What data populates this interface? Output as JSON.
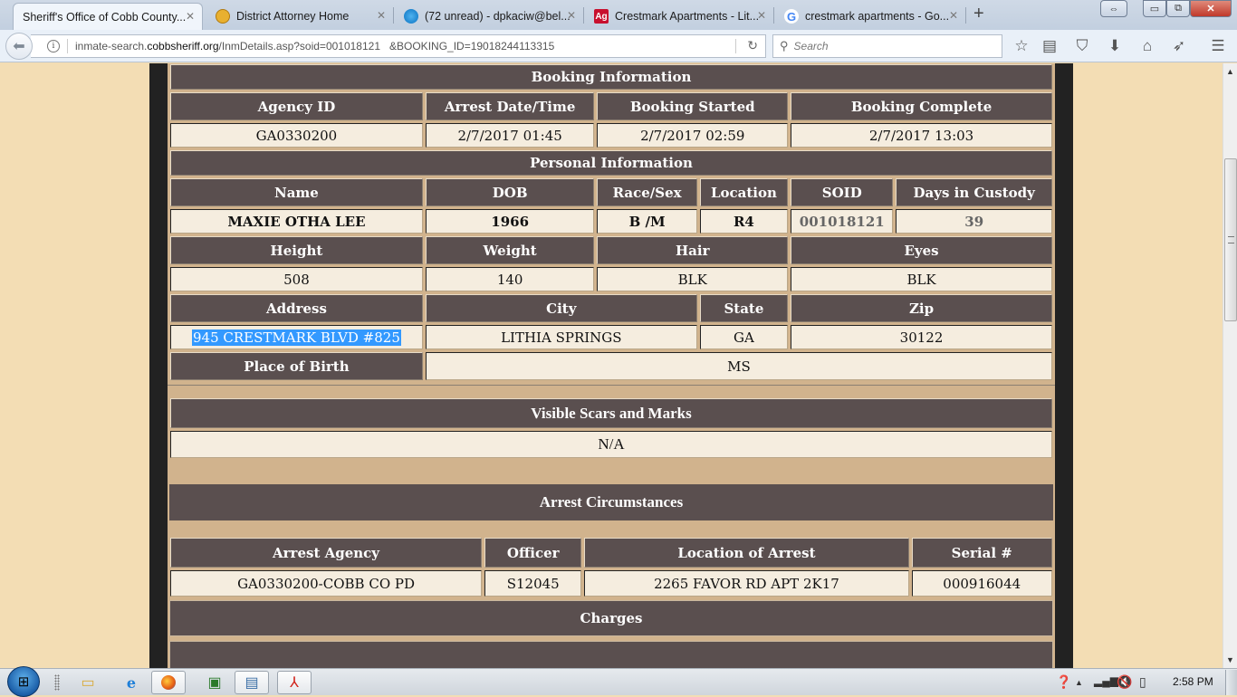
{
  "browser": {
    "tabs": [
      {
        "title": "Sheriff's Office of Cobb County...",
        "favicon": "blank",
        "active": true
      },
      {
        "title": "District Attorney Home",
        "favicon": "seal-icon",
        "active": false
      },
      {
        "title": "(72 unread) - dpkaciw@bel...",
        "favicon": "att-globe-icon",
        "active": false
      },
      {
        "title": "Crestmark Apartments - Lit...",
        "favicon": "apartments-ag-icon",
        "favicon_text": "Ag",
        "active": false
      },
      {
        "title": "crestmark apartments - Go...",
        "favicon": "google-g-icon",
        "favicon_text": "G",
        "active": false
      }
    ],
    "tab_close_glyph": "✕",
    "new_tab_glyph": "+",
    "url_prefix": "inmate-search.",
    "url_domain": "cobbsheriff.org",
    "url_path": "/InmDetails.asp?soid=001018121   &BOOKING_ID=19018244113315",
    "search_placeholder": "Search",
    "toolbar_icons": [
      "bookmark-star-icon",
      "reading-list-icon",
      "pocket-icon",
      "download-icon",
      "home-icon",
      "send-icon",
      "menu-icon"
    ]
  },
  "page": {
    "booking": {
      "section_title": "Booking Information",
      "headers": [
        "Agency ID",
        "Arrest Date/Time",
        "Booking Started",
        "Booking Complete"
      ],
      "values": [
        "GA0330200",
        "2/7/2017 01:45",
        "2/7/2017 02:59",
        "2/7/2017 13:03"
      ]
    },
    "personal": {
      "section_title": "Personal Information",
      "row1_headers": [
        "Name",
        "DOB",
        "Race/Sex",
        "Location",
        "SOID",
        "Days in Custody"
      ],
      "row1_values": [
        "MAXIE OTHA LEE",
        "1966",
        "B /M",
        "R4",
        "001018121",
        "39"
      ],
      "row2_headers": [
        "Height",
        "Weight",
        "Hair",
        "Eyes"
      ],
      "row2_values": [
        "508",
        "140",
        "BLK",
        "BLK"
      ],
      "row3_headers": [
        "Address",
        "City",
        "State",
        "Zip"
      ],
      "row3_values": [
        "945 CRESTMARK BLVD #825",
        "LITHIA SPRINGS",
        "GA",
        "30122"
      ],
      "place_of_birth_label": "Place of Birth",
      "place_of_birth_value": "MS"
    },
    "scars": {
      "section_title": "Visible Scars and Marks",
      "value": "N/A"
    },
    "arrest": {
      "section_title": "Arrest Circumstances",
      "headers": [
        "Arrest Agency",
        "Officer",
        "Location of Arrest",
        "Serial #"
      ],
      "values": [
        "GA0330200-COBB CO PD",
        "S12045",
        "2265 FAVOR RD APT 2K17",
        "000916044"
      ]
    },
    "charges": {
      "section_title": "Charges"
    }
  },
  "taskbar": {
    "clock": "2:58 PM",
    "apps": [
      "file-explorer-icon",
      "internet-explorer-icon",
      "firefox-icon",
      "task-manager-icon",
      "document-viewer-icon",
      "acrobat-icon"
    ]
  }
}
